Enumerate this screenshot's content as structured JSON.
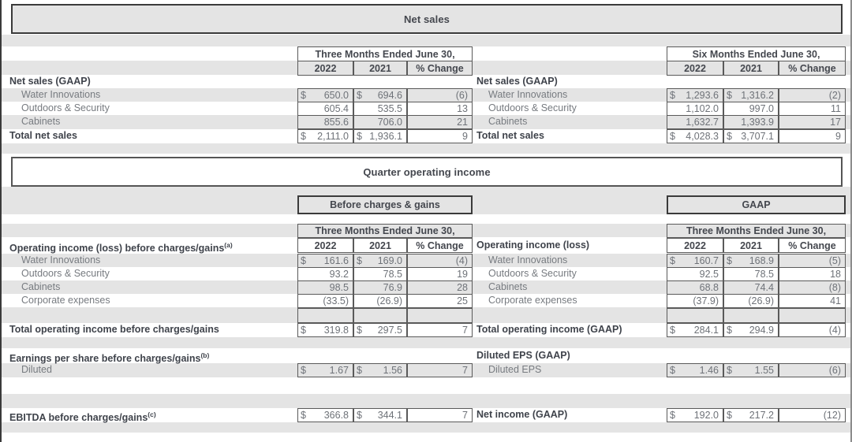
{
  "banners": {
    "net_sales": "Net sales",
    "quarter_operating_income": "Quarter operating income"
  },
  "segment_headers": {
    "before_charges": "Before charges & gains",
    "gaap": "GAAP"
  },
  "period_headers": {
    "three_months": "Three Months Ended June 30,",
    "six_months": "Six Months Ended June 30,"
  },
  "columns": {
    "year_2022": "2022",
    "year_2021": "2021",
    "pct_change": "% Change"
  },
  "net_sales": {
    "left": {
      "period": "Three Months Ended June 30,",
      "title": "Net sales (GAAP)",
      "rows": [
        {
          "label": "Water Innovations",
          "v2022": "650.0",
          "v2021": "694.6",
          "pct": "(6)",
          "dollar": true,
          "shade": "g"
        },
        {
          "label": "Outdoors & Security",
          "v2022": "605.4",
          "v2021": "535.5",
          "pct": "13",
          "dollar": false,
          "shade": "w"
        },
        {
          "label": "Cabinets",
          "v2022": "855.6",
          "v2021": "706.0",
          "pct": "21",
          "dollar": false,
          "shade": "g"
        }
      ],
      "total": {
        "label": "Total net sales",
        "v2022": "2,111.0",
        "v2021": "1,936.1",
        "pct": "9",
        "dollar": true
      }
    },
    "right": {
      "period": "Six Months Ended June 30,",
      "title": "Net sales (GAAP)",
      "rows": [
        {
          "label": "Water Innovations",
          "v2022": "1,293.6",
          "v2021": "1,316.2",
          "pct": "(2)",
          "dollar": true,
          "shade": "g"
        },
        {
          "label": "Outdoors & Security",
          "v2022": "1,102.0",
          "v2021": "997.0",
          "pct": "11",
          "dollar": false,
          "shade": "w"
        },
        {
          "label": "Cabinets",
          "v2022": "1,632.7",
          "v2021": "1,393.9",
          "pct": "17",
          "dollar": false,
          "shade": "g"
        }
      ],
      "total": {
        "label": "Total net sales",
        "v2022": "4,028.3",
        "v2021": "3,707.1",
        "pct": "9",
        "dollar": true
      }
    }
  },
  "operating_income": {
    "left": {
      "segment": "Before charges & gains",
      "period": "Three Months Ended June 30,",
      "title": "Operating income (loss) before charges/gains",
      "title_note": "(a)",
      "rows": [
        {
          "label": "Water Innovations",
          "v2022": "161.6",
          "v2021": "169.0",
          "pct": "(4)",
          "dollar": true,
          "shade": "g"
        },
        {
          "label": "Outdoors & Security",
          "v2022": "93.2",
          "v2021": "78.5",
          "pct": "19",
          "dollar": false,
          "shade": "w"
        },
        {
          "label": "Cabinets",
          "v2022": "98.5",
          "v2021": "76.9",
          "pct": "28",
          "dollar": false,
          "shade": "g"
        },
        {
          "label": "Corporate expenses",
          "v2022": "(33.5)",
          "v2021": "(26.9)",
          "pct": "25",
          "dollar": false,
          "shade": "w"
        }
      ],
      "total": {
        "label": "Total operating income before charges/gains",
        "v2022": "319.8",
        "v2021": "297.5",
        "pct": "7",
        "dollar": true
      }
    },
    "right": {
      "segment": "GAAP",
      "period": "Three Months Ended June 30,",
      "title": "Operating income (loss)",
      "title_note": "",
      "rows": [
        {
          "label": "Water Innovations",
          "v2022": "160.7",
          "v2021": "168.9",
          "pct": "(5)",
          "dollar": true,
          "shade": "g"
        },
        {
          "label": "Outdoors & Security",
          "v2022": "92.5",
          "v2021": "78.5",
          "pct": "18",
          "dollar": false,
          "shade": "w"
        },
        {
          "label": "Cabinets",
          "v2022": "68.8",
          "v2021": "74.4",
          "pct": "(8)",
          "dollar": false,
          "shade": "g"
        },
        {
          "label": "Corporate expenses",
          "v2022": "(37.9)",
          "v2021": "(26.9)",
          "pct": "41",
          "dollar": false,
          "shade": "w"
        }
      ],
      "total": {
        "label": "Total operating income (GAAP)",
        "v2022": "284.1",
        "v2021": "294.9",
        "pct": "(4)",
        "dollar": true
      }
    }
  },
  "eps": {
    "left": {
      "title": "Earnings per share before charges/gains",
      "title_note": "(b)",
      "row": {
        "label": "Diluted",
        "v2022": "1.67",
        "v2021": "1.56",
        "pct": "7",
        "dollar": true
      }
    },
    "right": {
      "title": "Diluted EPS (GAAP)",
      "title_note": "",
      "row": {
        "label": "Diluted EPS",
        "v2022": "1.46",
        "v2021": "1.55",
        "pct": "(6)",
        "dollar": true
      }
    }
  },
  "bottom": {
    "left": {
      "label": "EBITDA before charges/gains",
      "note": "(c)",
      "v2022": "366.8",
      "v2021": "344.1",
      "pct": "7",
      "dollar": true
    },
    "right": {
      "label": "Net income (GAAP)",
      "note": "",
      "v2022": "192.0",
      "v2021": "217.2",
      "pct": "(12)",
      "dollar": true
    }
  },
  "colors": {
    "stripe": "#e4e4e4",
    "border": "#5a5a5a",
    "heading_text": "#44474e",
    "value_text": "#6e7278"
  }
}
